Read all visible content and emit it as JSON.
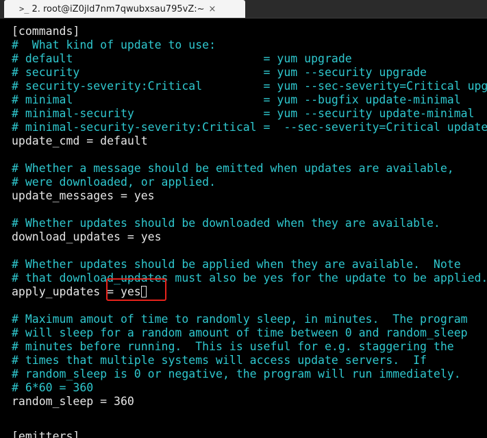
{
  "tab": {
    "prompt_icon": ">_",
    "title": "2. root@iZ0jld7nm7qwubxsau795vZ:~",
    "close_glyph": "×"
  },
  "terminal": {
    "lines": [
      {
        "kind": "plain",
        "text": "[commands]"
      },
      {
        "kind": "comment",
        "text": "#  What kind of update to use:"
      },
      {
        "kind": "comment",
        "text": "# default                            = yum upgrade"
      },
      {
        "kind": "comment",
        "text": "# security                           = yum --security upgrade"
      },
      {
        "kind": "comment",
        "text": "# security-severity:Critical         = yum --sec-severity=Critical upgrade"
      },
      {
        "kind": "comment",
        "text": "# minimal                            = yum --bugfix update-minimal"
      },
      {
        "kind": "comment",
        "text": "# minimal-security                   = yum --security update-minimal"
      },
      {
        "kind": "comment",
        "text": "# minimal-security-severity:Critical =  --sec-severity=Critical update-minimal"
      },
      {
        "kind": "plain",
        "text": "update_cmd = default"
      },
      {
        "kind": "plain",
        "text": ""
      },
      {
        "kind": "comment",
        "text": "# Whether a message should be emitted when updates are available,"
      },
      {
        "kind": "comment",
        "text": "# were downloaded, or applied."
      },
      {
        "kind": "plain",
        "text": "update_messages = yes"
      },
      {
        "kind": "plain",
        "text": ""
      },
      {
        "kind": "comment",
        "text": "# Whether updates should be downloaded when they are available."
      },
      {
        "kind": "plain",
        "text": "download_updates = yes"
      },
      {
        "kind": "plain",
        "text": ""
      },
      {
        "kind": "comment",
        "text": "# Whether updates should be applied when they are available.  Note"
      },
      {
        "kind": "comment",
        "text": "# that download_updates must also be yes for the update to be applied."
      },
      {
        "kind": "cursor",
        "text": "apply_updates = yes"
      },
      {
        "kind": "plain",
        "text": ""
      },
      {
        "kind": "comment",
        "text": "# Maximum amout of time to randomly sleep, in minutes.  The program"
      },
      {
        "kind": "comment",
        "text": "# will sleep for a random amount of time between 0 and random_sleep"
      },
      {
        "kind": "comment",
        "text": "# minutes before running.  This is useful for e.g. staggering the"
      },
      {
        "kind": "comment",
        "text": "# times that multiple systems will access update servers.  If"
      },
      {
        "kind": "comment",
        "text": "# random_sleep is 0 or negative, the program will run immediately."
      },
      {
        "kind": "comment",
        "text": "# 6*60 = 360"
      },
      {
        "kind": "plain",
        "text": "random_sleep = 360"
      }
    ],
    "partial_last_line": "[emitters]"
  },
  "colors": {
    "comment": "#2fc8cf",
    "plain": "#e6e6e6",
    "background": "#000000",
    "highlight": "#e8231c"
  }
}
